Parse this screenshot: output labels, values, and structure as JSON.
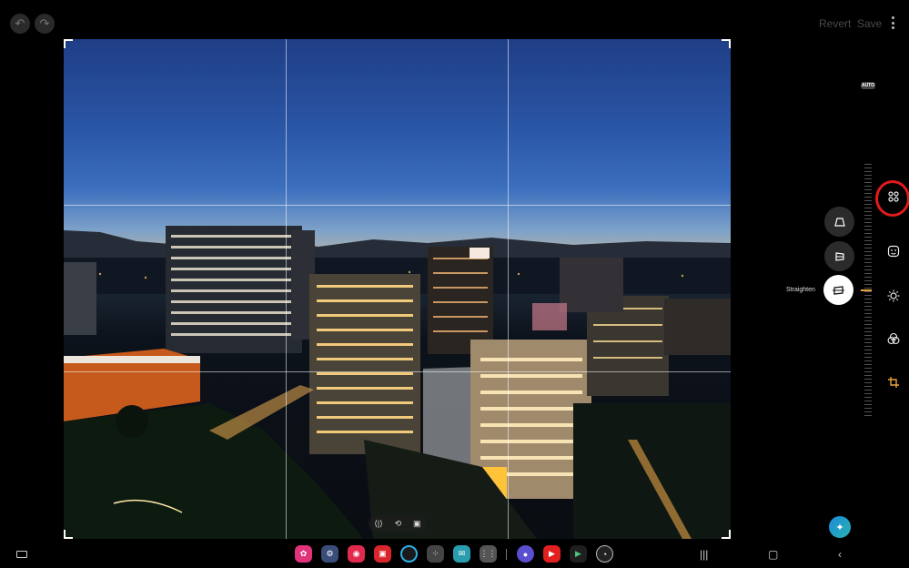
{
  "header": {
    "revert_label": "Revert",
    "save_label": "Save"
  },
  "right_panel": {
    "auto_label": "AUTO",
    "straighten_label": "Straighten"
  },
  "icons": {
    "undo": "undo-icon",
    "redo": "redo-icon",
    "more": "more-vertical-icon",
    "filters": "filters-icon",
    "sticker": "sticker-icon",
    "brightness": "brightness-icon",
    "color": "color-icon",
    "crop": "crop-rotate-icon",
    "ai_edit": "ai-edit-icon"
  },
  "colors": {
    "accent": "#e9a23b",
    "highlight": "#e11a1a"
  }
}
